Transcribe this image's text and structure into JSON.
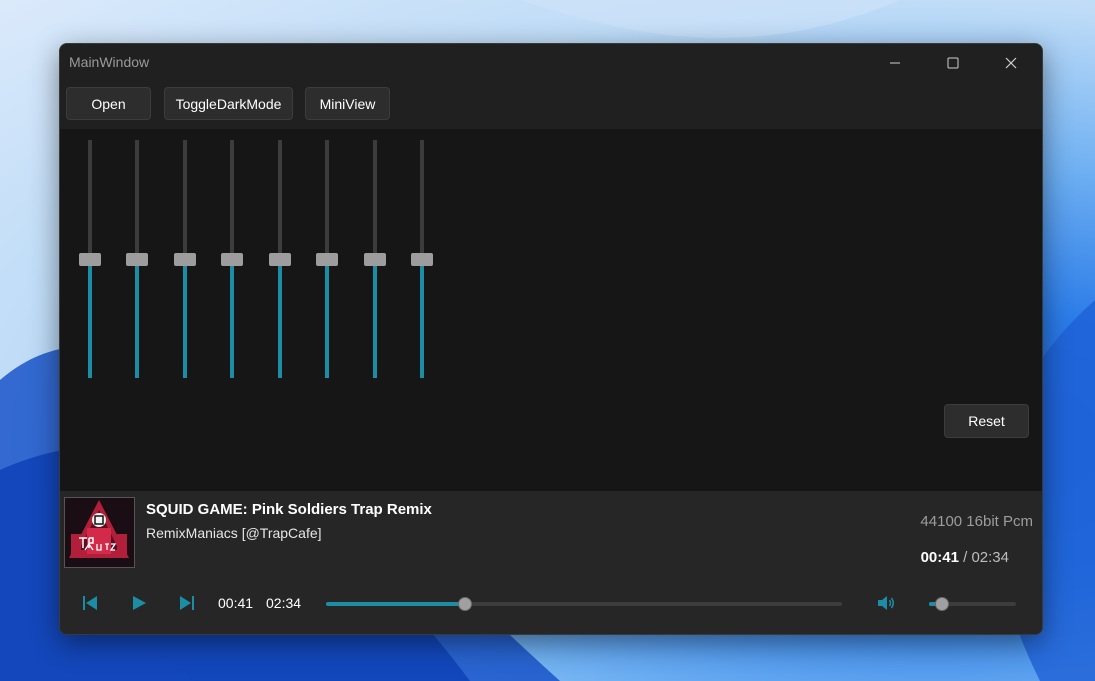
{
  "window": {
    "title": "MainWindow"
  },
  "toolbar": {
    "open_label": "Open",
    "dark_label": "ToggleDarkMode",
    "mini_label": "MiniView"
  },
  "equalizer": {
    "bands": [
      {
        "level": 0.5
      },
      {
        "level": 0.5
      },
      {
        "level": 0.5
      },
      {
        "level": 0.5
      },
      {
        "level": 0.5
      },
      {
        "level": 0.5
      },
      {
        "level": 0.5
      },
      {
        "level": 0.5
      }
    ],
    "reset_label": "Reset"
  },
  "track": {
    "title": "SQUID GAME: Pink Soldiers Trap Remix",
    "artist": "RemixManiacs [@TrapCafe]",
    "format": "44100 16bit Pcm",
    "current_time": "00:41",
    "separator": "/",
    "total_time": "02:34",
    "progress": 0.27,
    "album_art_text": "TRAP MUSIC"
  },
  "controls": {
    "elapsed": "00:41",
    "duration": "02:34",
    "volume": 0.15
  },
  "colors": {
    "accent": "#1b8ea6",
    "background": "#191919",
    "panel": "#262626"
  }
}
